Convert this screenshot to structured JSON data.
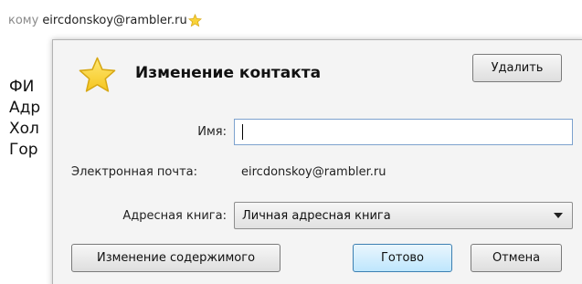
{
  "header": {
    "to_label": "кому",
    "to_address": "eircdonskoy@rambler.ru"
  },
  "background_lines": [
    "ФИ",
    "Адр",
    "Хол",
    "Гор"
  ],
  "dialog": {
    "title": "Изменение контакта",
    "delete_button": "Удалить",
    "name_label": "Имя:",
    "name_value": "",
    "email_label": "Электронная почта:",
    "email_value": "eircdonskoy@rambler.ru",
    "address_book_label": "Адресная книга:",
    "address_book_value": "Личная адресная книга",
    "edit_content_button": "Изменение содержимого",
    "done_button": "Готово",
    "cancel_button": "Отмена"
  },
  "icons": {
    "header_star": "star-icon",
    "dialog_star": "star-icon"
  },
  "colors": {
    "star_fill": "#f9d33a",
    "star_stroke": "#d7a814",
    "done_border": "#3c7fb1",
    "input_border": "#7da2ce"
  }
}
